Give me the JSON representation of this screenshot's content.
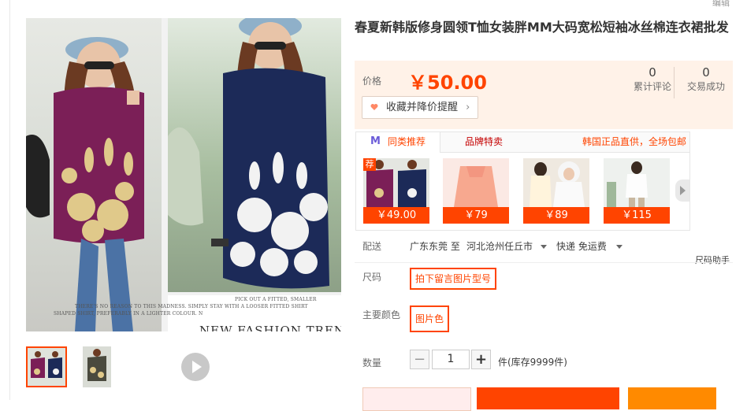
{
  "product": {
    "title": "春夏新韩版修身圆领T恤女装胖MM大码宽松短袖冰丝棉连衣裙批发",
    "edit_label": "编辑"
  },
  "gallery": {
    "caption_lines": [
      "PICK OUT A FITTED, SMALLER",
      "THERE'S NO REASON TO THIS MADNESS. SIMPLY STAY WITH A LOOSER FITTED SHIRT",
      "SHAPED SHIRT, PREFERABLY IN A LIGHTER COLOUR. N"
    ],
    "trend_text": "NEW FASHION TREND"
  },
  "price_box": {
    "price_label": "价格",
    "price": "￥50.00",
    "reviews_count": "0",
    "reviews_label": "累计评论",
    "sales_count": "0",
    "sales_label": "交易成功",
    "collect_label": "收藏并降价提醒"
  },
  "recommend": {
    "tab_similar": "同类推荐",
    "tab_brand": "品牌特卖",
    "promo": "韩国正品直供，全场包邮",
    "badge": "荐",
    "items": [
      {
        "price": "￥49.00"
      },
      {
        "price": "￥79"
      },
      {
        "price": "￥89"
      },
      {
        "price": "￥115"
      }
    ]
  },
  "shipping": {
    "label": "配送",
    "from": "广东东莞 至",
    "to": "河北沧州任丘市",
    "method": "快递 免运费",
    "size_helper": "尺码助手"
  },
  "size": {
    "label": "尺码",
    "option": "拍下留言图片型号"
  },
  "color": {
    "label": "主要颜色",
    "option": "图片色"
  },
  "quantity": {
    "label": "数量",
    "value": "1",
    "minus": "−",
    "plus": "+",
    "stock": "件(库存9999件)"
  },
  "colors": {
    "accent": "#ff4400",
    "price_bg": "#fff2e8"
  }
}
